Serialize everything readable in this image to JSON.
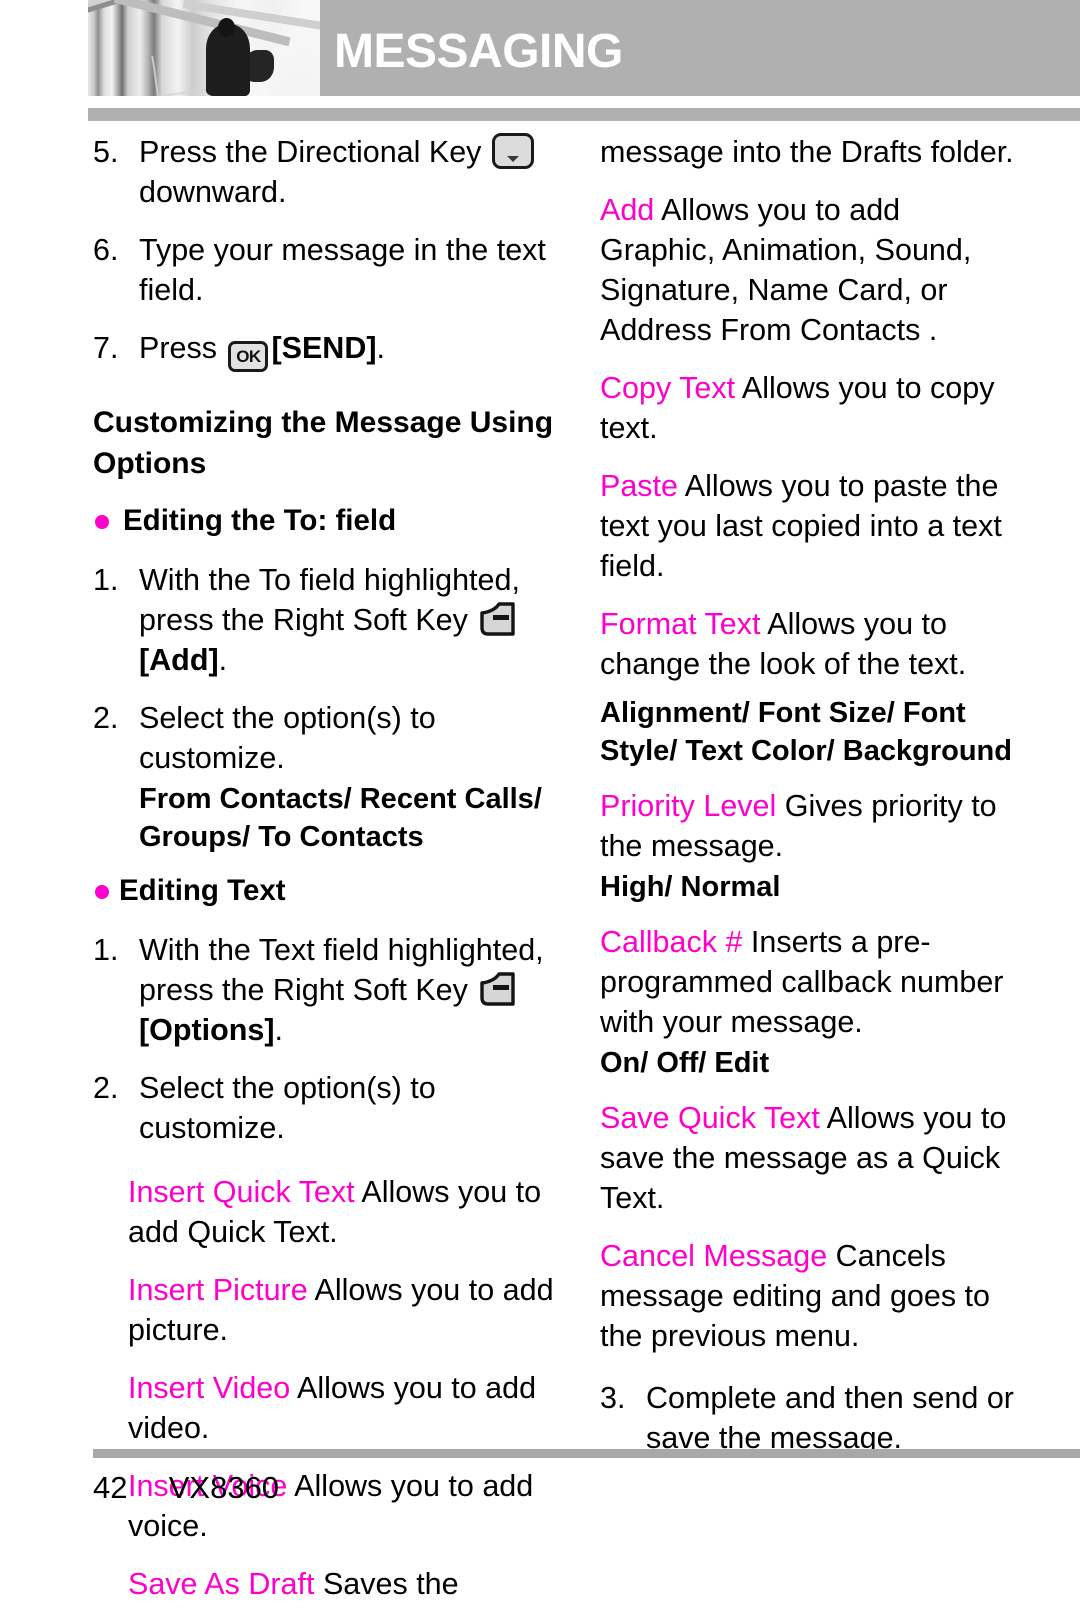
{
  "page": {
    "header_title": "MESSAGING",
    "footer_page_number": "42",
    "footer_model": "VX8360",
    "accent_color": "#ff00cc",
    "header_band_color": "#b0b0b0"
  },
  "icons": {
    "directional_key": "directional-key-down-icon",
    "ok_key": "ok-key-icon",
    "ok_key_label": "OK",
    "right_soft_key": "right-soft-key-icon",
    "bullet": "bullet-dot-icon"
  },
  "left_column": {
    "steps_top": [
      {
        "num": "5.",
        "text_before": "Press the Directional Key",
        "icon": "directional-key-down-icon",
        "text_after": "downward."
      },
      {
        "num": "6.",
        "text_before": "Type your message in the text field.",
        "icon": "",
        "text_after": ""
      },
      {
        "num": "7.",
        "text_before": "Press",
        "icon": "ok-key-icon",
        "text_after": "[SEND]."
      }
    ],
    "step5_line1": "Press the Directional Key",
    "step5_line2": "downward.",
    "step6_text": "Type your message in the text field.",
    "step7_before": "Press",
    "step7_after": "[SEND]",
    "step7_period": ".",
    "section_heading": "Customizing the Message Using Options",
    "bullet_1": "Editing the To: field",
    "item_1_1_before": "With the To field highlighted, press the Right Soft Key",
    "item_1_1_after": "[Add]",
    "item_1_1_period": ".",
    "item_1_2": "Select the option(s) to customize.",
    "item_1_2_options": "From Contacts/ Recent Calls/ Groups/ To Contacts",
    "bullet_2": "Editing Text",
    "item_2_1_before": "With the Text field highlighted, press the Right Soft Key",
    "item_2_1_after": "[Options]",
    "item_2_1_period": ".",
    "item_2_2": "Select the option(s) to customize.",
    "options": [
      {
        "name": "Insert Quick Text",
        "desc": "Allows you to add Quick Text."
      },
      {
        "name": "Insert Picture",
        "desc": "Allows you to add picture."
      },
      {
        "name": "Insert Video",
        "desc": "Allows you to add video."
      },
      {
        "name": "Insert Voice",
        "desc": "Allows you to add voice."
      },
      {
        "name": "Save As Draft",
        "desc": "Saves the"
      }
    ]
  },
  "right_column": {
    "continuation": "message into the Drafts folder.",
    "options": [
      {
        "name": "Add",
        "desc": "Allows you to add Graphic, Animation, Sound, Signature, Name Card, or Address From Contacts ."
      },
      {
        "name": "Copy Text",
        "desc": "Allows you to copy text."
      },
      {
        "name": "Paste",
        "desc": "Allows you to paste the text you last copied into a text field."
      },
      {
        "name": "Format Text",
        "desc": "Allows you to change the look of the text."
      }
    ],
    "format_text_values": "Alignment/ Font Size/ Font Style/ Text Color/ Background",
    "priority": {
      "name": "Priority Level",
      "desc": "Gives priority to the message."
    },
    "priority_values": "High/ Normal",
    "callback": {
      "name": "Callback #",
      "desc": "Inserts a pre-programmed callback number with your message."
    },
    "callback_values": "On/ Off/ Edit",
    "save_quick_text": {
      "name": "Save Quick Text",
      "desc": "Allows you to save the message as a Quick Text."
    },
    "cancel_message": {
      "name": "Cancel Message",
      "desc": "Cancels message editing and goes to the previous menu."
    },
    "final_step_num": "3.",
    "final_step_text": "Complete and then send or save the message."
  }
}
